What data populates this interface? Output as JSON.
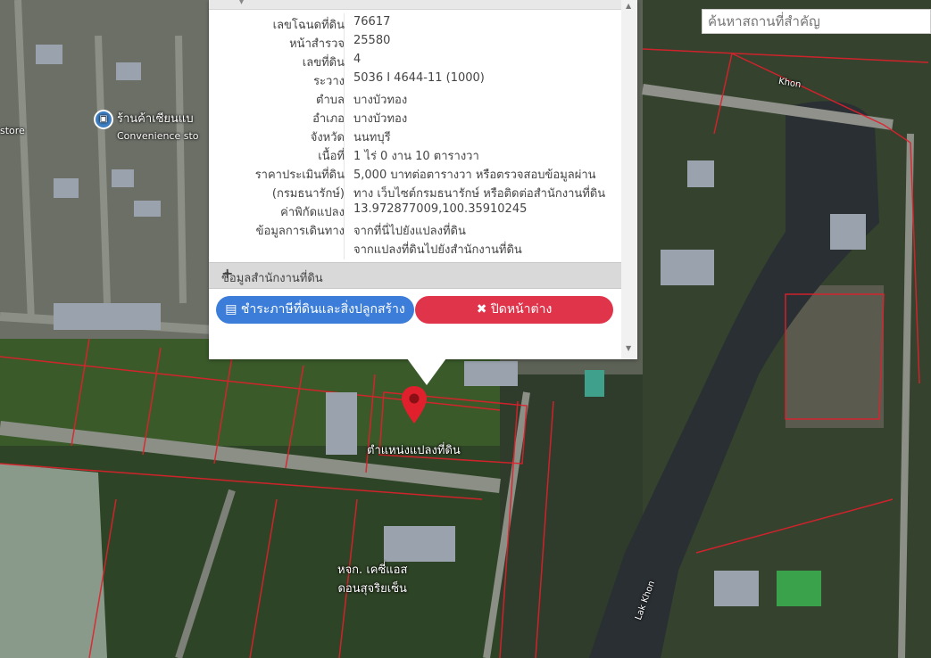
{
  "search": {
    "placeholder": "ค้นหาสถานที่สำคัญ"
  },
  "map": {
    "pois": [
      {
        "label": "ร้านค้าเซียนแบ",
        "sub": "Convenience sto",
        "icon": "shop-icon"
      },
      {
        "label": "หจก. เคซี่แอส",
        "sub": "ดอนสุจริยเซ็น"
      },
      {
        "label": "Lak Khon"
      },
      {
        "label": "Khon"
      },
      {
        "label": "store"
      }
    ],
    "pin_label": "ตำแหน่งแปลงที่ดิน"
  },
  "popup": {
    "rows": [
      {
        "label": "เลขโฉนดที่ดิน",
        "value": "76617"
      },
      {
        "label": "หน้าสำรวจ",
        "value": "25580"
      },
      {
        "label": "เลขที่ดิน",
        "value": "4"
      },
      {
        "label": "ระวาง",
        "value": "5036 I 4644-11 (1000)"
      },
      {
        "label": "ตำบล",
        "value": "บางบัวทอง"
      },
      {
        "label": "อำเภอ",
        "value": "บางบัวทอง"
      },
      {
        "label": "จังหวัด",
        "value": "นนทบุรี"
      },
      {
        "label": "เนื้อที่",
        "value": "1 ไร่ 0 งาน 10 ตารางวา"
      },
      {
        "label": "ราคาประเมินที่ดิน",
        "value": "5,000 บาทต่อตารางวา หรือตรวจสอบข้อมูลผ่าน"
      },
      {
        "label": "(กรมธนารักษ์)",
        "value": "ทาง เว็บไซต์กรมธนารักษ์ หรือติดต่อสำนักงานที่ดิน"
      },
      {
        "label": "ค่าพิกัดแปลง",
        "value": "13.972877009,100.35910245"
      },
      {
        "label": "ข้อมูลการเดินทาง",
        "value": "จากที่นี่ไปยังแปลงที่ดิน"
      },
      {
        "label": "",
        "value": "จากแปลงที่ดินไปยังสำนักงานที่ดิน"
      }
    ],
    "section_title": "ข้อมูลสำนักงานที่ดิน",
    "button_blue": "ชำระภาษีที่ดินและสิ่งปลูกสร้าง",
    "button_red": "ปิดหน้าต่าง",
    "colors": {
      "blue": "#3b7dd8",
      "red": "#e0344b",
      "pin": "#e0202c"
    }
  }
}
